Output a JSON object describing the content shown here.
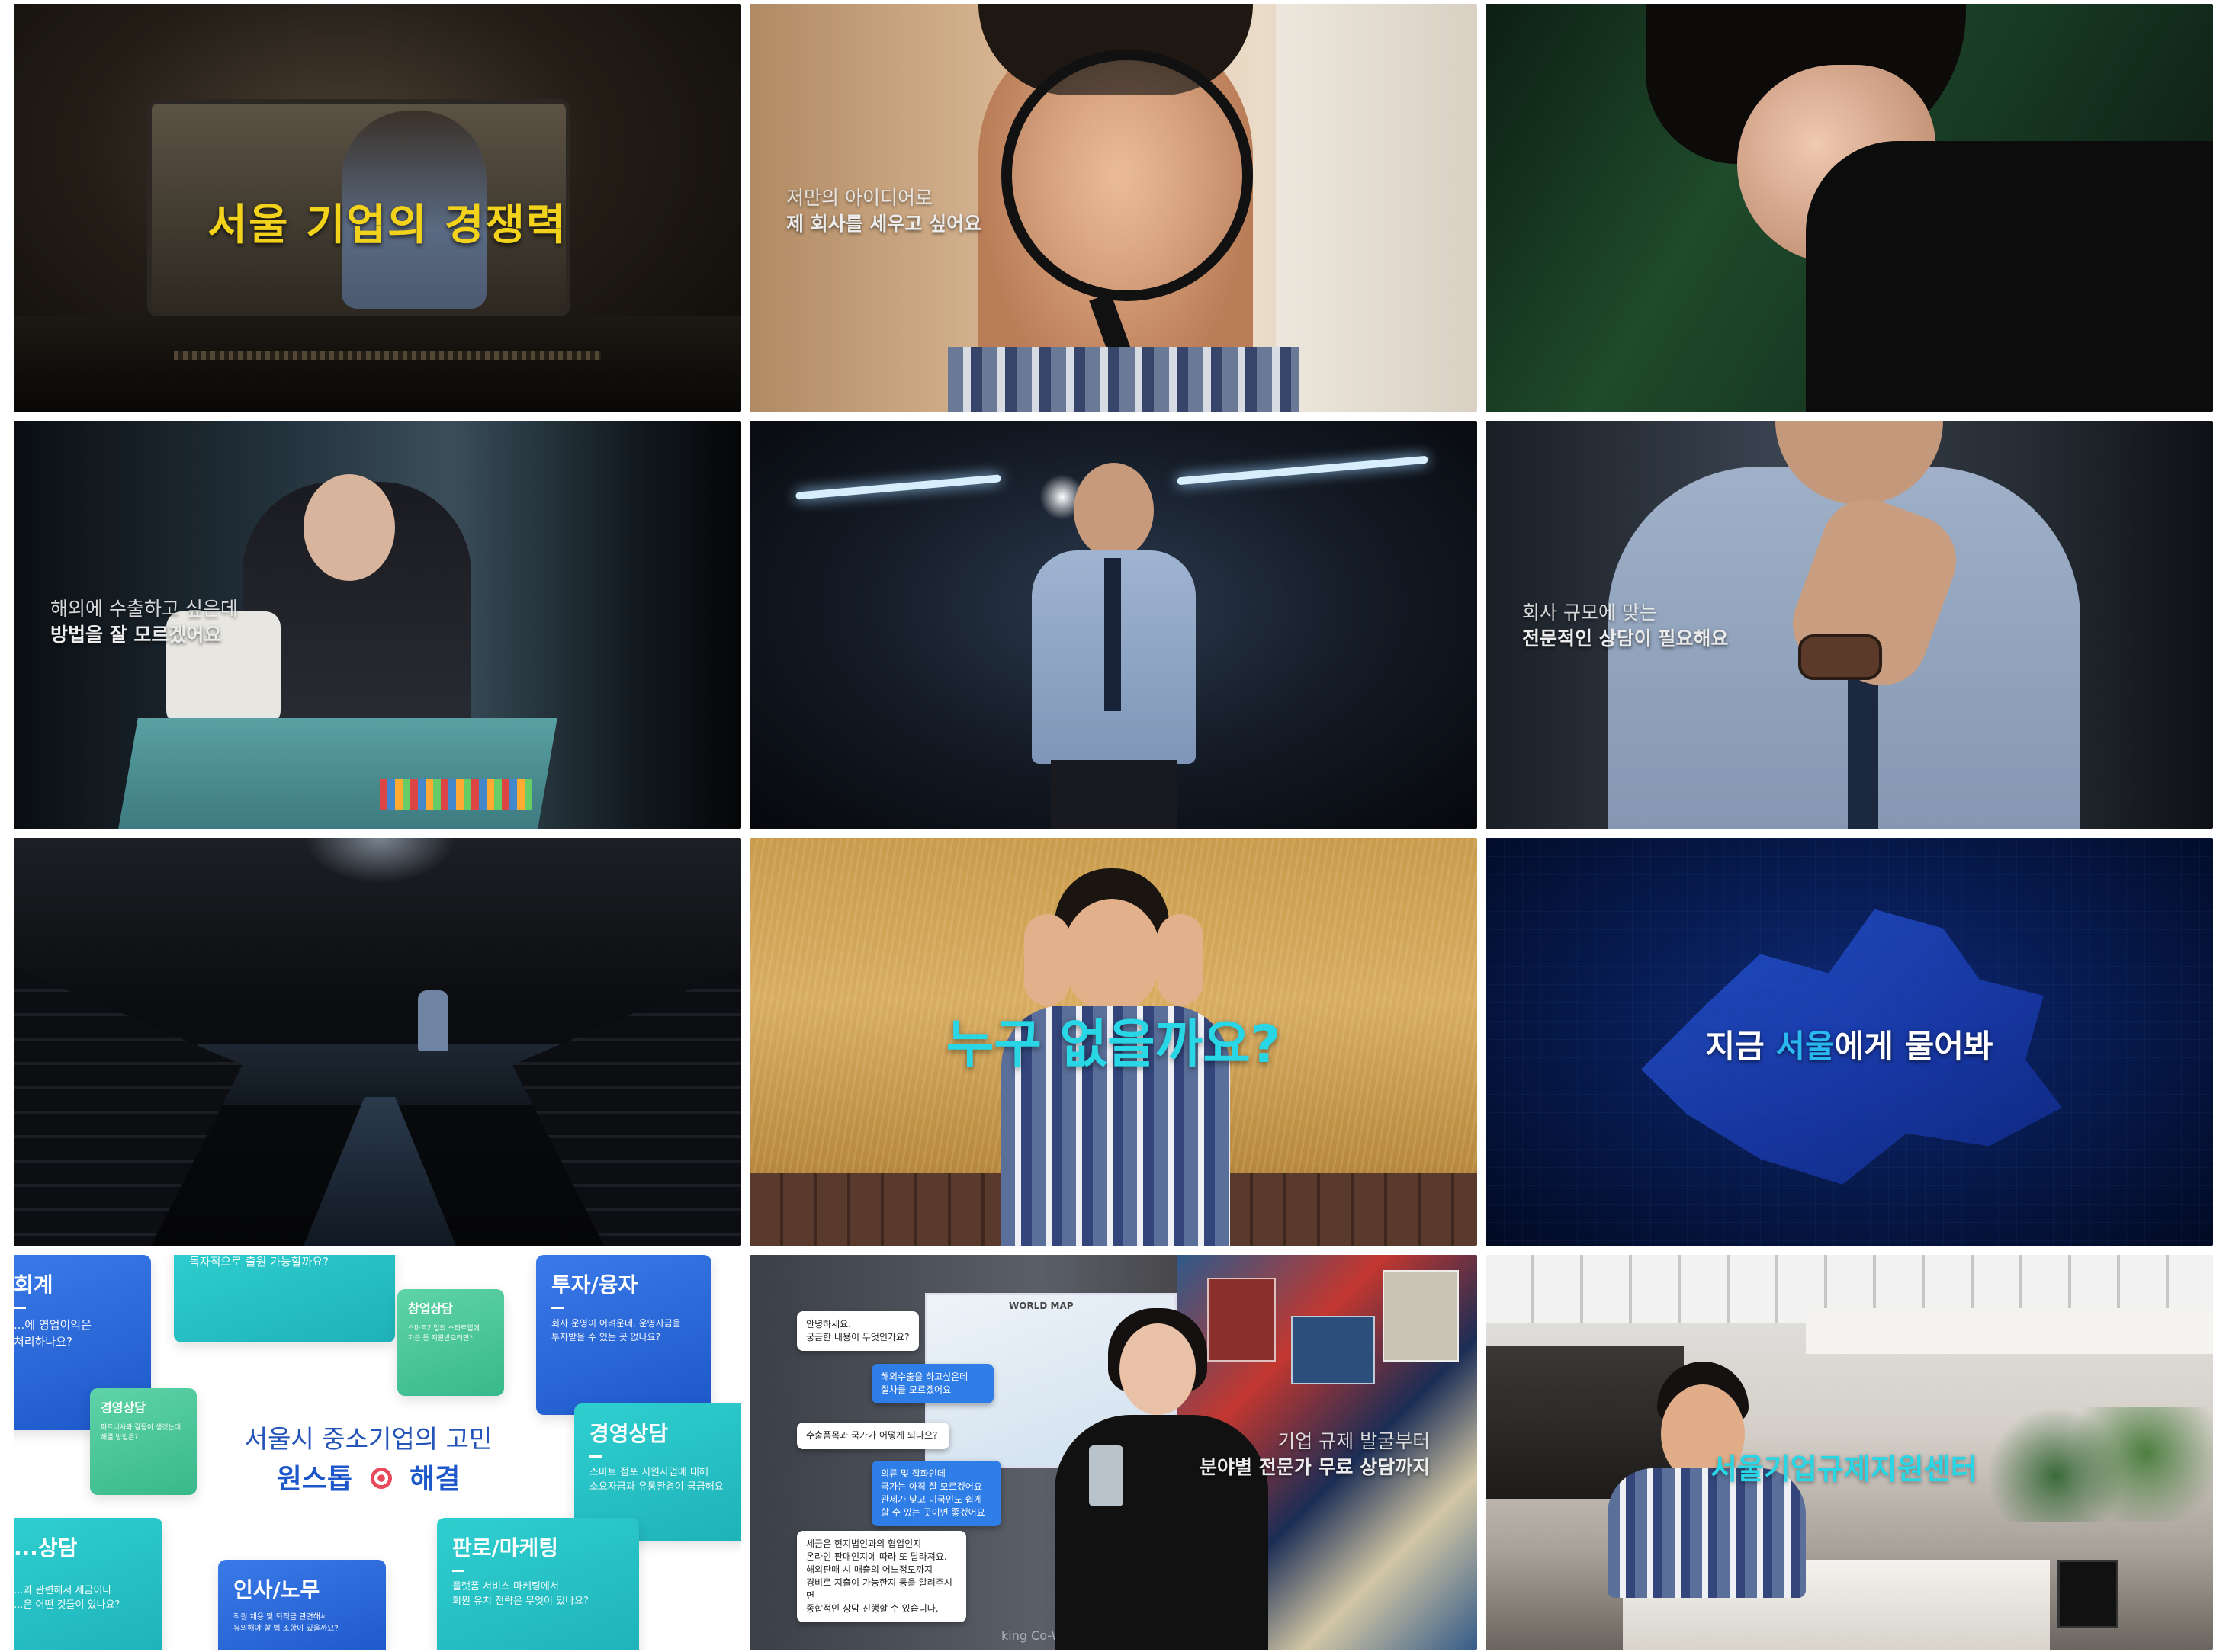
{
  "frames": {
    "f1": {
      "headline": "서울 기업의 경쟁력"
    },
    "f2": {
      "line1": "저만의 아이디어로",
      "line2": "제 회사를 세우고 싶어요"
    },
    "f4": {
      "line1": "해외에 수출하고 싶은데",
      "line2": "방법을 잘 모르겠어요"
    },
    "f6": {
      "line1": "회사 규모에 맞는",
      "line2": "전문적인 상담이 필요해요"
    },
    "f8": {
      "headline": "누구 없을까요?"
    },
    "f9": {
      "prefix": "지금 ",
      "highlight": "서울",
      "suffix": "에게 물어봐"
    },
    "f10": {
      "title": "서울시 중소기업의 고민",
      "solve_prefix": "원스톱",
      "solve_suffix": "해결",
      "cards": {
        "accounting": {
          "title": "회계",
          "body": "...에 영업이익은\n처리하나요?"
        },
        "export_q": {
          "body": "독자적으로 출원 가능할까요?"
        },
        "startup": {
          "title": "창업상담",
          "body": "스마트기업의 스타트업에\n자금 등 지원받으려면?"
        },
        "invest": {
          "title": "투자/융자",
          "body": "회사 운영이 어려운데, 운영자금을\n투자받을 수 있는 곳 없나요?"
        },
        "mgmt_small": {
          "title": "경영상담",
          "body": "파트너사와 갈등이 생겼는데\n해결 방법은?"
        },
        "mgmt": {
          "title": "경영상담",
          "body": "스마트 점포 지원사업에 대해\n소요자금과 유통환경이 궁금해요"
        },
        "tax": {
          "title": "...상담",
          "body": "...과 관련해서 세금이나\n...은 어떤 것들이 있나요?"
        },
        "hr": {
          "title": "인사/노무",
          "body": "직원 채용 및 퇴직금 관련해서\n유의해야 할 법 조항이 있을까요?"
        },
        "marketing": {
          "title": "판로/마케팅",
          "body": "플랫폼 서비스 마케팅에서\n회원 유치 전략은 무엇이 있나요?"
        }
      }
    },
    "f11": {
      "map_label": "WORLD MAP",
      "bubbles": [
        "안녕하세요.\n궁금한 내용이 무엇인가요?",
        "해외수출을 하고싶은데\n절차를 모르겠어요",
        "수출품목과 국가가 어떻게 되나요?",
        "의류 및 잡화인데\n국가는 아직 잘 모르겠어요\n관세가 낮고 미국인도 쉽게\n할 수 있는 곳이면 좋겠어요",
        "세금은 현지법인과의 협업인지\n온라인 판매인지에 따라 또 달라져요.\n해외판매 시 매출의 어느정도까지\n경비로 지출이 가능한지 등을 알려주시면\n종합적인 상담 진행할 수 있습니다."
      ],
      "line1": "기업 규제 발굴부터",
      "line2": "분야별 전문가 무료 상담까지",
      "sign": "king Co-W"
    },
    "f12": {
      "headline": "서울기업규제지원센터"
    }
  },
  "colors": {
    "yellow": "#f2d21a",
    "cyan": "#29d6e6",
    "blue_accent": "#3a7ae8",
    "target_red": "#e74a5a"
  }
}
